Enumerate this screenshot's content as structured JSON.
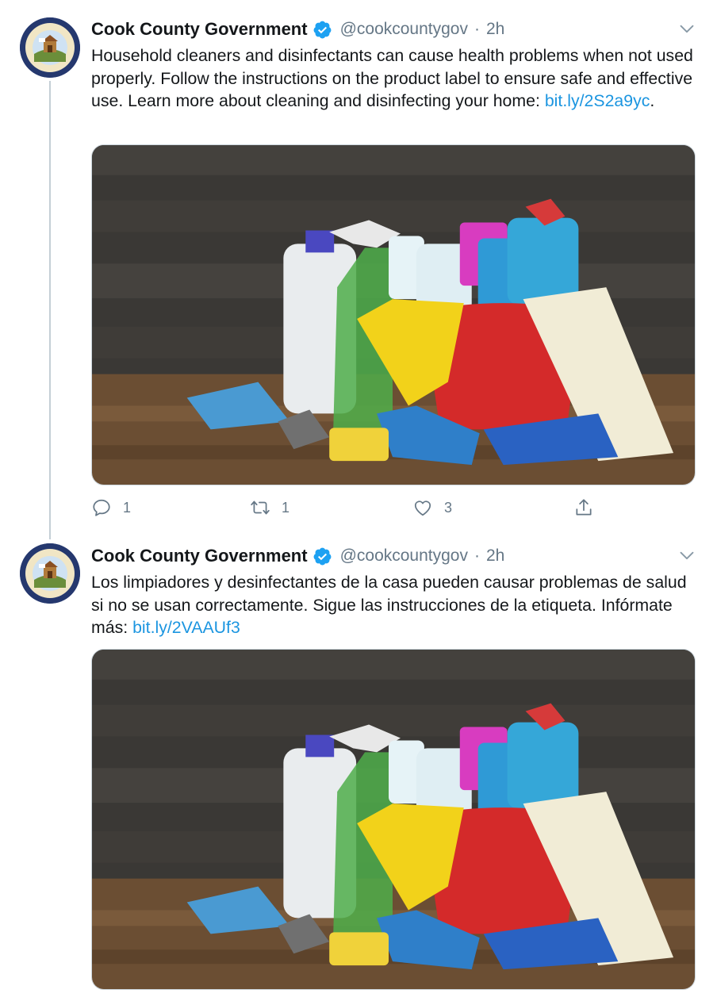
{
  "tweets": [
    {
      "author_name": "Cook County Government",
      "handle": "@cookcountygov",
      "separator": "·",
      "time": "2h",
      "text_before": "Household cleaners and disinfectants can cause health problems when not used properly. Follow the instructions on the product label to ensure safe and effective use. Learn more about cleaning and disinfecting your home: ",
      "link": "bit.ly/2S2a9yc",
      "text_after": ".",
      "replies": "1",
      "retweets": "1",
      "likes": "3"
    },
    {
      "author_name": "Cook County Government",
      "handle": "@cookcountygov",
      "separator": "·",
      "time": "2h",
      "text_before": "Los limpiadores y desinfectantes de la casa pueden causar problemas de salud si no se usan correctamente. Sigue las instrucciones de la etiqueta. Infórmate más: ",
      "link": "bit.ly/2VAAUf3",
      "text_after": ""
    }
  ],
  "icons": {
    "verified": "verified-badge-icon",
    "caret": "chevron-down-icon",
    "reply": "reply-icon",
    "retweet": "retweet-icon",
    "like": "heart-icon",
    "share": "share-icon"
  },
  "colors": {
    "link": "#1b95e0",
    "secondary_text": "#657786",
    "verified": "#1da1f2"
  }
}
